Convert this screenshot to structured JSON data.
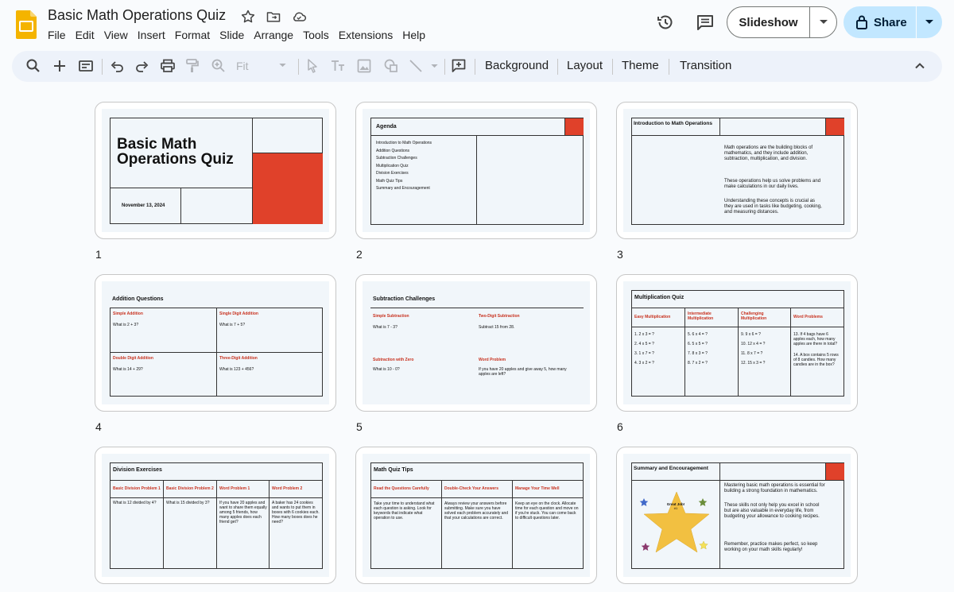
{
  "header": {
    "doc_title": "Basic Math Operations Quiz",
    "menu": [
      "File",
      "Edit",
      "View",
      "Insert",
      "Format",
      "Slide",
      "Arrange",
      "Tools",
      "Extensions",
      "Help"
    ],
    "slideshow_label": "Slideshow",
    "share_label": "Share",
    "icons": [
      "star-icon",
      "move-folder-icon",
      "cloud-status-icon",
      "version-history-icon",
      "comments-icon"
    ]
  },
  "toolbar": {
    "zoom_value": "Fit",
    "background_label": "Background",
    "layout_label": "Layout",
    "theme_label": "Theme",
    "transition_label": "Transition"
  },
  "colors": {
    "accent_red": "#e0412a",
    "share_bg": "#c2e7ff",
    "toolbar_bg": "#edf2fa"
  },
  "slides": [
    {
      "number": "1",
      "title": "Basic Math Operations Quiz",
      "date": "November 13, 2024"
    },
    {
      "number": "2",
      "title": "Agenda",
      "items": [
        "Introduction to Math Operations",
        "Addition Questions",
        "Subtraction Challenges",
        "Multiplication Quiz",
        "Division Exercises",
        "Math Quiz Tips",
        "Summary and Encouragement"
      ]
    },
    {
      "number": "3",
      "title": "Introduction to Math Operations",
      "paragraphs": [
        "Math operations are the building blocks of mathematics, and they include addition, subtraction, multiplication, and division.",
        "These operations help us solve problems and make calculations in our daily lives.",
        "Understanding these concepts is crucial as they are used in tasks like budgeting, cooking, and measuring distances."
      ]
    },
    {
      "number": "4",
      "title": "Addition Questions",
      "cells": [
        {
          "heading": "Simple Addition",
          "text": "What is 2 + 3?"
        },
        {
          "heading": "Single Digit Addition",
          "text": "What is 7 + 5?"
        },
        {
          "heading": "Double Digit Addition",
          "text": "What is 14 + 29?"
        },
        {
          "heading": "Three-Digit Addition",
          "text": "What is 123 + 456?"
        }
      ]
    },
    {
      "number": "5",
      "title": "Subtraction Challenges",
      "cells": [
        {
          "heading": "Simple Subtraction",
          "text": "What is 7 - 3?"
        },
        {
          "heading": "Two-Digit Subtraction",
          "text": "Subtract 15 from 28."
        },
        {
          "heading": "Subtraction with Zero",
          "text": "What is 10 - 0?"
        },
        {
          "heading": "Word Problem",
          "text": "If you have 20 apples and give away 5, how many apples are left?"
        }
      ]
    },
    {
      "number": "6",
      "title": "Multiplication Quiz",
      "columns": [
        {
          "heading": "Easy Multiplication",
          "items": [
            "1. 2 x 3 = ?",
            "2. 4 x 5 = ?",
            "3. 1 x 7 = ?",
            "4. 3 x 2 = ?"
          ]
        },
        {
          "heading": "Intermediate Multiplication",
          "items": [
            "5. 6 x 4 = ?",
            "6. 5 x 5 = ?",
            "7. 8 x 3 = ?",
            "8. 7 x 2 = ?"
          ]
        },
        {
          "heading": "Challenging Multiplication",
          "items": [
            "9. 9 x 6 = ?",
            "10. 12 x 4 = ?",
            "11. 8 x 7 = ?",
            "12. 15 x 3 = ?"
          ]
        },
        {
          "heading": "Word Problems",
          "items": [
            "13. If 4 bags have 6 apples each, how many apples are there in total?",
            "14. A box contains 5 rows of 8 candies. How many candies are in the box?"
          ]
        }
      ]
    },
    {
      "number": "7",
      "title": "Division Exercises",
      "columns": [
        {
          "heading": "Basic Division Problem 1",
          "text": "What is 12 divided by 4?"
        },
        {
          "heading": "Basic Division Problem 2",
          "text": "What is 15 divided by 3?"
        },
        {
          "heading": "Word Problem 1",
          "text": "If you have 20 apples and want to share them equally among 5 friends, how many apples does each friend get?"
        },
        {
          "heading": "Word Problem 2",
          "text": "A baker has 24 cookies and wants to put them in boxes with 6 cookies each. How many boxes does he need?"
        }
      ]
    },
    {
      "number": "8",
      "title": "Math Quiz Tips",
      "columns": [
        {
          "heading": "Read the Questions Carefully",
          "text": "Take your time to understand what each question is asking. Look for keywords that indicate what operation to use."
        },
        {
          "heading": "Double-Check Your Answers",
          "text": "Always review your answers before submitting. Make sure you have solved each problem accurately and that your calculations are correct."
        },
        {
          "heading": "Manage Your Time Well",
          "text": "Keep an eye on the clock. Allocate time for each question and move on if you're stuck. You can come back to difficult questions later."
        }
      ]
    },
    {
      "number": "9",
      "title": "Summary and Encouragement",
      "star_text": "Great Job!",
      "star_sub": "#1",
      "paragraphs": [
        "Mastering basic math operations is essential for building a strong foundation in mathematics.",
        "These skills not only help you excel in school but are also valuable in everyday life, from budgeting your allowance to cooking recipes.",
        "Remember, practice makes perfect, so keep working on your math skills regularly!"
      ]
    }
  ]
}
